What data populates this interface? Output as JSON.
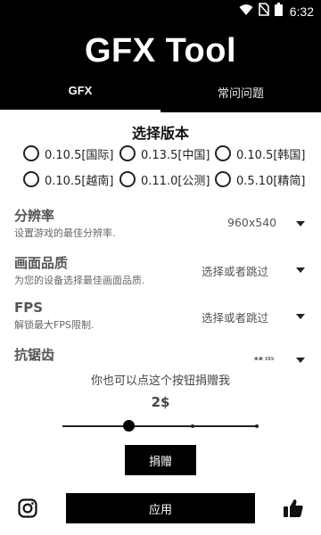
{
  "status_bar": {
    "time": "6:32"
  },
  "app": {
    "title": "GFX Tool"
  },
  "tabs": [
    {
      "label": "GFX",
      "selected": true
    },
    {
      "label": "常问问题",
      "selected": false
    }
  ],
  "version_section": {
    "title": "选择版本",
    "options": [
      {
        "label": "0.10.5[国际]",
        "selected": false
      },
      {
        "label": "0.13.5[中国]",
        "selected": false
      },
      {
        "label": "0.10.5[韩国]",
        "selected": false
      },
      {
        "label": "0.10.5[越南]",
        "selected": false
      },
      {
        "label": "0.11.0[公测]",
        "selected": false
      },
      {
        "label": "0.5.10[精简]",
        "selected": false
      }
    ]
  },
  "settings": {
    "resolution": {
      "title": "分辨率",
      "description": "设置游戏的最佳分辨率.",
      "value": "960x540"
    },
    "graphics": {
      "title": "画面品质",
      "description": "为您的设备选择最佳画面品质.",
      "value": "选择或者跳过"
    },
    "fps": {
      "title": "FPS",
      "description": "解锁最大FPS限制.",
      "value": "选择或者跳过"
    },
    "antialiasing": {
      "title": "抗锯齿",
      "value": "禁用"
    }
  },
  "donate": {
    "text": "你也可以点这个按钮捐赠我",
    "amount": "2$",
    "slider_position": 0.33,
    "button_label": "捐赠"
  },
  "bottom_bar": {
    "apply_label": "应用",
    "left_icon": "instagram-icon",
    "right_icon": "thumbs-up-icon"
  }
}
